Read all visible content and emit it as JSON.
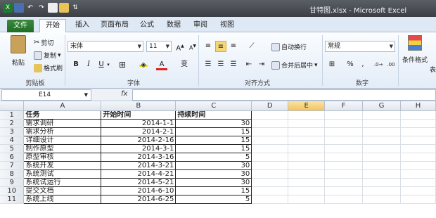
{
  "window": {
    "title": "甘特图.xlsx - Microsoft Excel"
  },
  "tabs": [
    "文件",
    "开始",
    "插入",
    "页面布局",
    "公式",
    "数据",
    "审阅",
    "视图"
  ],
  "clipboard": {
    "paste": "粘贴",
    "cut": "剪切",
    "copy": "复制",
    "format_painter": "格式刷",
    "group": "剪贴板"
  },
  "font": {
    "name": "宋体",
    "size": "11",
    "bold": "B",
    "italic": "I",
    "underline": "U",
    "phonetic": "变",
    "group": "字体"
  },
  "alignment": {
    "wrap": "自动换行",
    "merge": "合并后居中",
    "group": "对齐方式"
  },
  "number": {
    "format": "常规",
    "percent": "%",
    "comma": ",",
    "group": "数字"
  },
  "styles": {
    "conditional": "条件格式",
    "more": "表"
  },
  "formula_bar": {
    "cell_ref": "E14",
    "fx": "fx",
    "value": ""
  },
  "columns": [
    "A",
    "B",
    "C",
    "D",
    "E",
    "F",
    "G",
    "H"
  ],
  "active_column": "E",
  "sheet": {
    "headers": [
      "任务",
      "开始时间",
      "持续时间"
    ],
    "rows": [
      [
        "需求调研",
        "2014-1-1",
        "30"
      ],
      [
        "需求分析",
        "2014-2-1",
        "15"
      ],
      [
        "详细设计",
        "2014-2-16",
        "15"
      ],
      [
        "制作原型",
        "2014-3-1",
        "15"
      ],
      [
        "原型审核",
        "2014-3-16",
        "5"
      ],
      [
        "系统开发",
        "2014-3-21",
        "30"
      ],
      [
        "系统测试",
        "2014-4-21",
        "30"
      ],
      [
        "系统试运行",
        "2014-5-21",
        "30"
      ],
      [
        "提交文档",
        "2014-6-10",
        "15"
      ],
      [
        "系统上线",
        "2014-6-25",
        "5"
      ]
    ]
  }
}
